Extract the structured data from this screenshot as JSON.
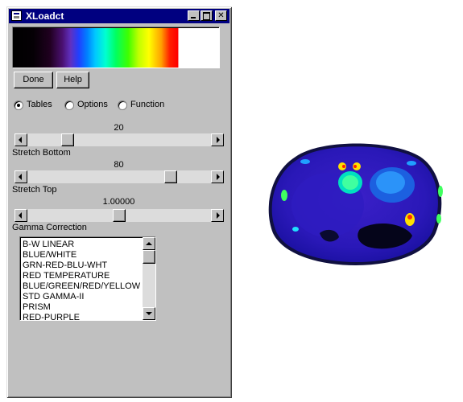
{
  "window": {
    "title": "XLoadct",
    "controls": {
      "minimize": "",
      "maximize": "",
      "close": "✕"
    }
  },
  "colorbar": {
    "description_colors": [
      "#000000",
      "#6030c0",
      "#0080ff",
      "#00ffd0",
      "#40ff00",
      "#ffff00",
      "#ff0000",
      "#ffffff"
    ]
  },
  "buttons": {
    "done": "Done",
    "help": "Help"
  },
  "radio": {
    "options": [
      {
        "label": "Tables",
        "selected": true
      },
      {
        "label": "Options",
        "selected": false
      },
      {
        "label": "Function",
        "selected": false
      }
    ]
  },
  "sliders": {
    "stretch_bottom": {
      "value": "20",
      "label": "Stretch Bottom",
      "level": 0.2
    },
    "stretch_top": {
      "value": "80",
      "label": "Stretch Top",
      "level": 0.8
    },
    "gamma": {
      "value": "1.00000",
      "label": "Gamma Correction",
      "level": 0.5
    }
  },
  "tables": {
    "items": [
      "B-W LINEAR",
      "BLUE/WHITE",
      "GRN-RED-BLU-WHT",
      "RED TEMPERATURE",
      "BLUE/GREEN/RED/YELLOW",
      "STD GAMMA-II",
      "PRISM",
      "RED-PURPLE"
    ]
  },
  "image": {
    "name": "ct-scan-image"
  }
}
